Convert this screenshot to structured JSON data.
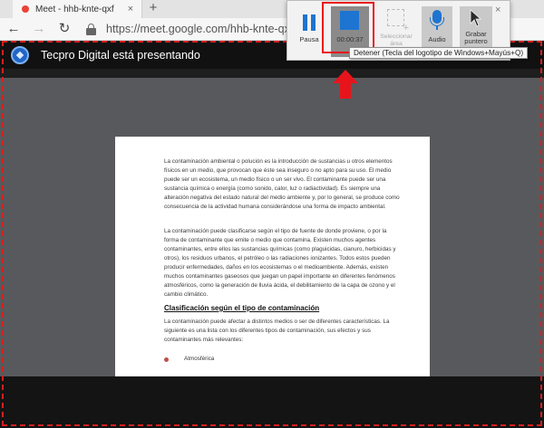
{
  "browser": {
    "tab": {
      "title": "Meet - hhb-knte-qxf",
      "close_icon": "×"
    },
    "new_tab_icon": "+",
    "nav": {
      "back_icon": "←",
      "forward_icon": "→",
      "reload_icon": "↻"
    },
    "url": "https://meet.google.com/hhb-knte-qxf?pli"
  },
  "meet": {
    "presenting_text": "Tecpro Digital está presentando"
  },
  "document": {
    "paragraphs": [
      "La contaminación ambiental o polución es la introducción de sustancias u otros elementos físicos en un medio, que provocan que éste sea inseguro o no apto para su uso. El medio puede ser un ecosistema, un medio físico o un ser vivo. El contaminante puede ser una sustancia química o energía (como sonido, calor, luz o radiactividad). Es siempre una alteración negativa del estado natural del medio ambiente y, por lo general, se produce como consecuencia de la actividad humana considerándose una forma de impacto ambiental.",
      "La contaminación puede clasificarse según el tipo de fuente de donde proviene, o por la forma de contaminante que emite o medio que contamina. Existen muchos agentes contaminantes, entre ellos las sustancias químicas (como plaguicidas, cianuro, herbicidas y otros), los residuos urbanos, el petróleo o las radiaciones ionizantes. Todos estos pueden producir enfermedades, daños en los ecosistemas o el medioambiente. Además, existen muchos contaminantes gaseosos que juegan un papel importante en diferentes fenómenos atmosféricos, como la generación de lluvia ácida, el debilitamiento de la capa de ozono y el cambio climático.",
      "La contaminación puede afectar a distintos medios o ser de diferentes características. La siguiente es una lista con los diferentes tipos de contaminación, sus efectos y sus contaminantes más relevantes:"
    ],
    "heading": "Clasificación según el tipo de contaminación",
    "bullets": [
      "Atmosférica"
    ]
  },
  "capture_toolbar": {
    "pause_label": "Pausa",
    "timer": "00:00:37",
    "select_area_label": "Seleccionar área",
    "audio_label": "Audio",
    "pointer_label": "Grabar puntero",
    "close_icon": "×",
    "tooltip": "Detener (Tecla del logotipo de Windows+Mayús+Q)"
  },
  "colors": {
    "accent_blue": "#1e74d1",
    "annotation_red": "#e8141b",
    "recording_border": "#d42020"
  },
  "icons": {
    "pause": "pause-icon",
    "stop": "stop-icon",
    "select_area": "select-area-icon",
    "audio": "microphone-icon",
    "pointer": "pointer-icon",
    "annotation": "red-up-arrow-icon"
  }
}
